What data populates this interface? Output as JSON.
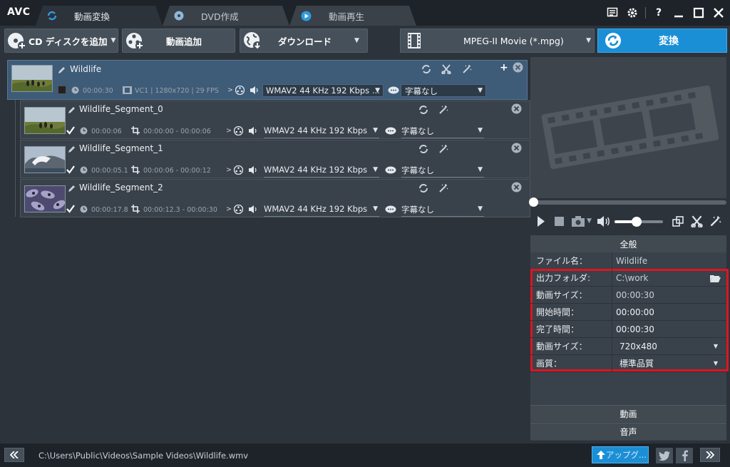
{
  "app": {
    "logo": "AVC"
  },
  "tabs": [
    {
      "label": "動画変換",
      "active": true
    },
    {
      "label": "DVD作成",
      "active": false
    },
    {
      "label": "動画再生",
      "active": false
    }
  ],
  "window_controls": {
    "help": "?"
  },
  "toolbar": {
    "add_cd_label": "CD ディスクを追加",
    "add_video_label": "動画追加",
    "download_label": "ダウンロード",
    "format_value": "MPEG-II Movie (*.mpg)",
    "convert_label": "変換"
  },
  "main_item": {
    "name": "Wildlife",
    "duration": "00:00:30",
    "video_info": "VC1 | 1280x720 | 29 FPS",
    "audio": "WMAV2 44 KHz 192 Kbps ...",
    "subtitle": "字幕なし"
  },
  "segments": [
    {
      "name": "Wildlife_Segment_0",
      "duration": "00:00:06",
      "range": "00:00:00 - 00:00:06",
      "audio": "WMAV2 44 KHz 192 Kbps",
      "subtitle": "字幕なし"
    },
    {
      "name": "Wildlife_Segment_1",
      "duration": "00:00:05.1",
      "range": "00:00:06 - 00:00:12",
      "audio": "WMAV2 44 KHz 192 Kbps",
      "subtitle": "字幕なし"
    },
    {
      "name": "Wildlife_Segment_2",
      "duration": "00:00:17.8",
      "range": "00:00:12.3 - 00:00:30",
      "audio": "WMAV2 44 KHz 192 Kbps",
      "subtitle": "字幕なし"
    }
  ],
  "player": {
    "seek_fraction": 0.0,
    "volume_fraction": 0.45
  },
  "properties": {
    "header": "全般",
    "rows": [
      {
        "key": "ファイル名：",
        "value": "Wildlife"
      },
      {
        "key": "出力フォルダ:",
        "value": "C:\\work"
      },
      {
        "key": "動画サイズ：",
        "value": "00:00:30"
      },
      {
        "key": "開始時間：",
        "value": "00:00:00"
      },
      {
        "key": "完了時間：",
        "value": "00:00:30"
      },
      {
        "key": "動画サイズ：",
        "value": "720x480"
      },
      {
        "key": "画質：",
        "value": "標準品質"
      }
    ],
    "video_section": "動画",
    "audio_section": "音声"
  },
  "status": {
    "path": "C:\\Users\\Public\\Videos\\Sample Videos\\Wildlife.wmv",
    "upgrade_label": "アップグ..."
  },
  "colors": {
    "accent": "#1a8fd6",
    "highlight_frame": "#e0141e",
    "selected_row": "#3e5b78"
  }
}
